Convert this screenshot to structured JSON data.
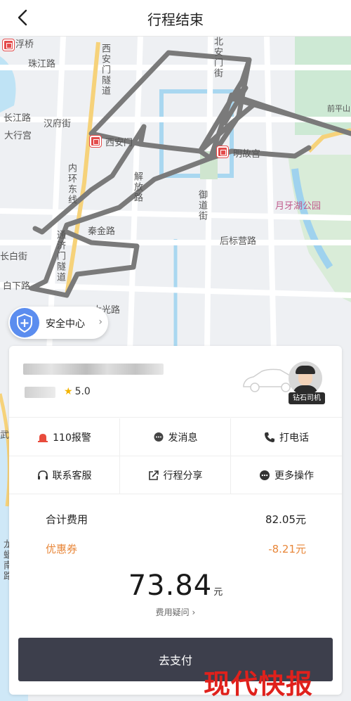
{
  "header": {
    "title": "行程结束",
    "back_icon": "chevron-left-icon"
  },
  "map": {
    "labels": {
      "fuqiao": "浮桥",
      "zhujianglu": "珠江路",
      "hanfujie": "汉府街",
      "changjianglu": "长江路",
      "daxinggong": "大行宫",
      "xianmen": "西安门",
      "mingugong": "明故宫",
      "yuedaohu": "月牙湖公园",
      "bianjinlu": "秦金路",
      "houbiaoyinglu": "后标营路",
      "zhongbailu": "长白街",
      "baixialu": "白下路",
      "daguanglu": "大光路",
      "qianpingshan": "前平山",
      "tunnel1": "西安门隧道",
      "tunnel2": "内环东线",
      "tunnel3": "通济门隧道",
      "jiefanglu": "解放路",
      "beianmenjie": "北安门街",
      "yudaojie": "御道街",
      "leftedge": "龙蟠南路",
      "wu": "武"
    }
  },
  "safety": {
    "label": "安全中心",
    "icon": "shield-icon"
  },
  "driver": {
    "rating": "5.0",
    "badge": "钻石司机"
  },
  "actions": [
    {
      "label": "110报警",
      "icon": "alarm-icon"
    },
    {
      "label": "发消息",
      "icon": "message-icon"
    },
    {
      "label": "打电话",
      "icon": "phone-icon"
    },
    {
      "label": "联系客服",
      "icon": "headset-icon"
    },
    {
      "label": "行程分享",
      "icon": "share-icon"
    },
    {
      "label": "更多操作",
      "icon": "more-icon"
    }
  ],
  "fees": {
    "total_label": "合计费用",
    "total_value": "82.05元",
    "coupon_label": "优惠券",
    "coupon_value": "-8.21元",
    "pay_amount": "73.84",
    "pay_unit": "元",
    "doubt_label": "费用疑问"
  },
  "pay_button": "去支付",
  "watermark": "现代快报",
  "colors": {
    "accent_blue": "#5b8def",
    "coupon_orange": "#e8873a",
    "pay_button": "#3d3f4c",
    "watermark_red": "#e0211c"
  }
}
